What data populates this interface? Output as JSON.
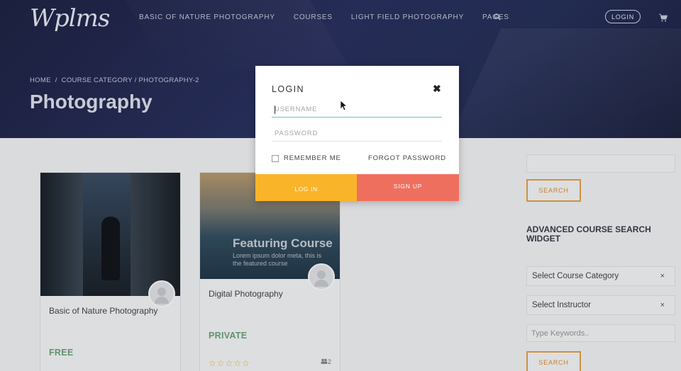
{
  "header": {
    "logo": "Wplms",
    "nav": [
      "BASIC OF NATURE PHOTOGRAPHY",
      "COURSES",
      "LIGHT FIELD PHOTOGRAPHY",
      "PAGES"
    ],
    "search_icon": "search-icon",
    "login_label": "LOGIN",
    "cart_icon": "cart-icon"
  },
  "hero": {
    "breadcrumb": [
      "HOME",
      "COURSE CATEGORY / PHOTOGRAPHY-2"
    ],
    "breadcrumb_separator": "/",
    "title": "Photography"
  },
  "courses": [
    {
      "title": "Basic of Nature Photography",
      "price": "FREE"
    },
    {
      "title": "Digital Photography",
      "price": "PRIVATE",
      "image_title": "Featuring Course",
      "image_subtitle": "Lorem ipsum dolor meta, this is the featured course",
      "rating": "☆☆☆☆☆",
      "students": "2"
    }
  ],
  "sidebar": {
    "search_button": "SEARCH",
    "widget_title": "ADVANCED COURSE SEARCH WIDGET",
    "category_select": "Select Course Category",
    "instructor_select": "Select Instructor",
    "clear_symbol": "×",
    "keywords_placeholder": "Type Keywords..",
    "search_button_2": "SEARCH"
  },
  "modal": {
    "title": "LOGIN",
    "close_symbol": "✖",
    "username_placeholder": "USERNAME",
    "password_placeholder": "PASSWORD",
    "remember_label": "REMEMBER ME",
    "forgot_label": "FORGOT PASSWORD",
    "login_button": "LOG IN",
    "signup_button": "SIGN UP"
  },
  "colors": {
    "hero_bg": "#262c55",
    "login_button": "#f9b429",
    "signup_button": "#ef6f5f",
    "accent_orange": "#e6a24a",
    "price_green": "#6aa37e",
    "focus_teal": "#6cc0c9"
  }
}
